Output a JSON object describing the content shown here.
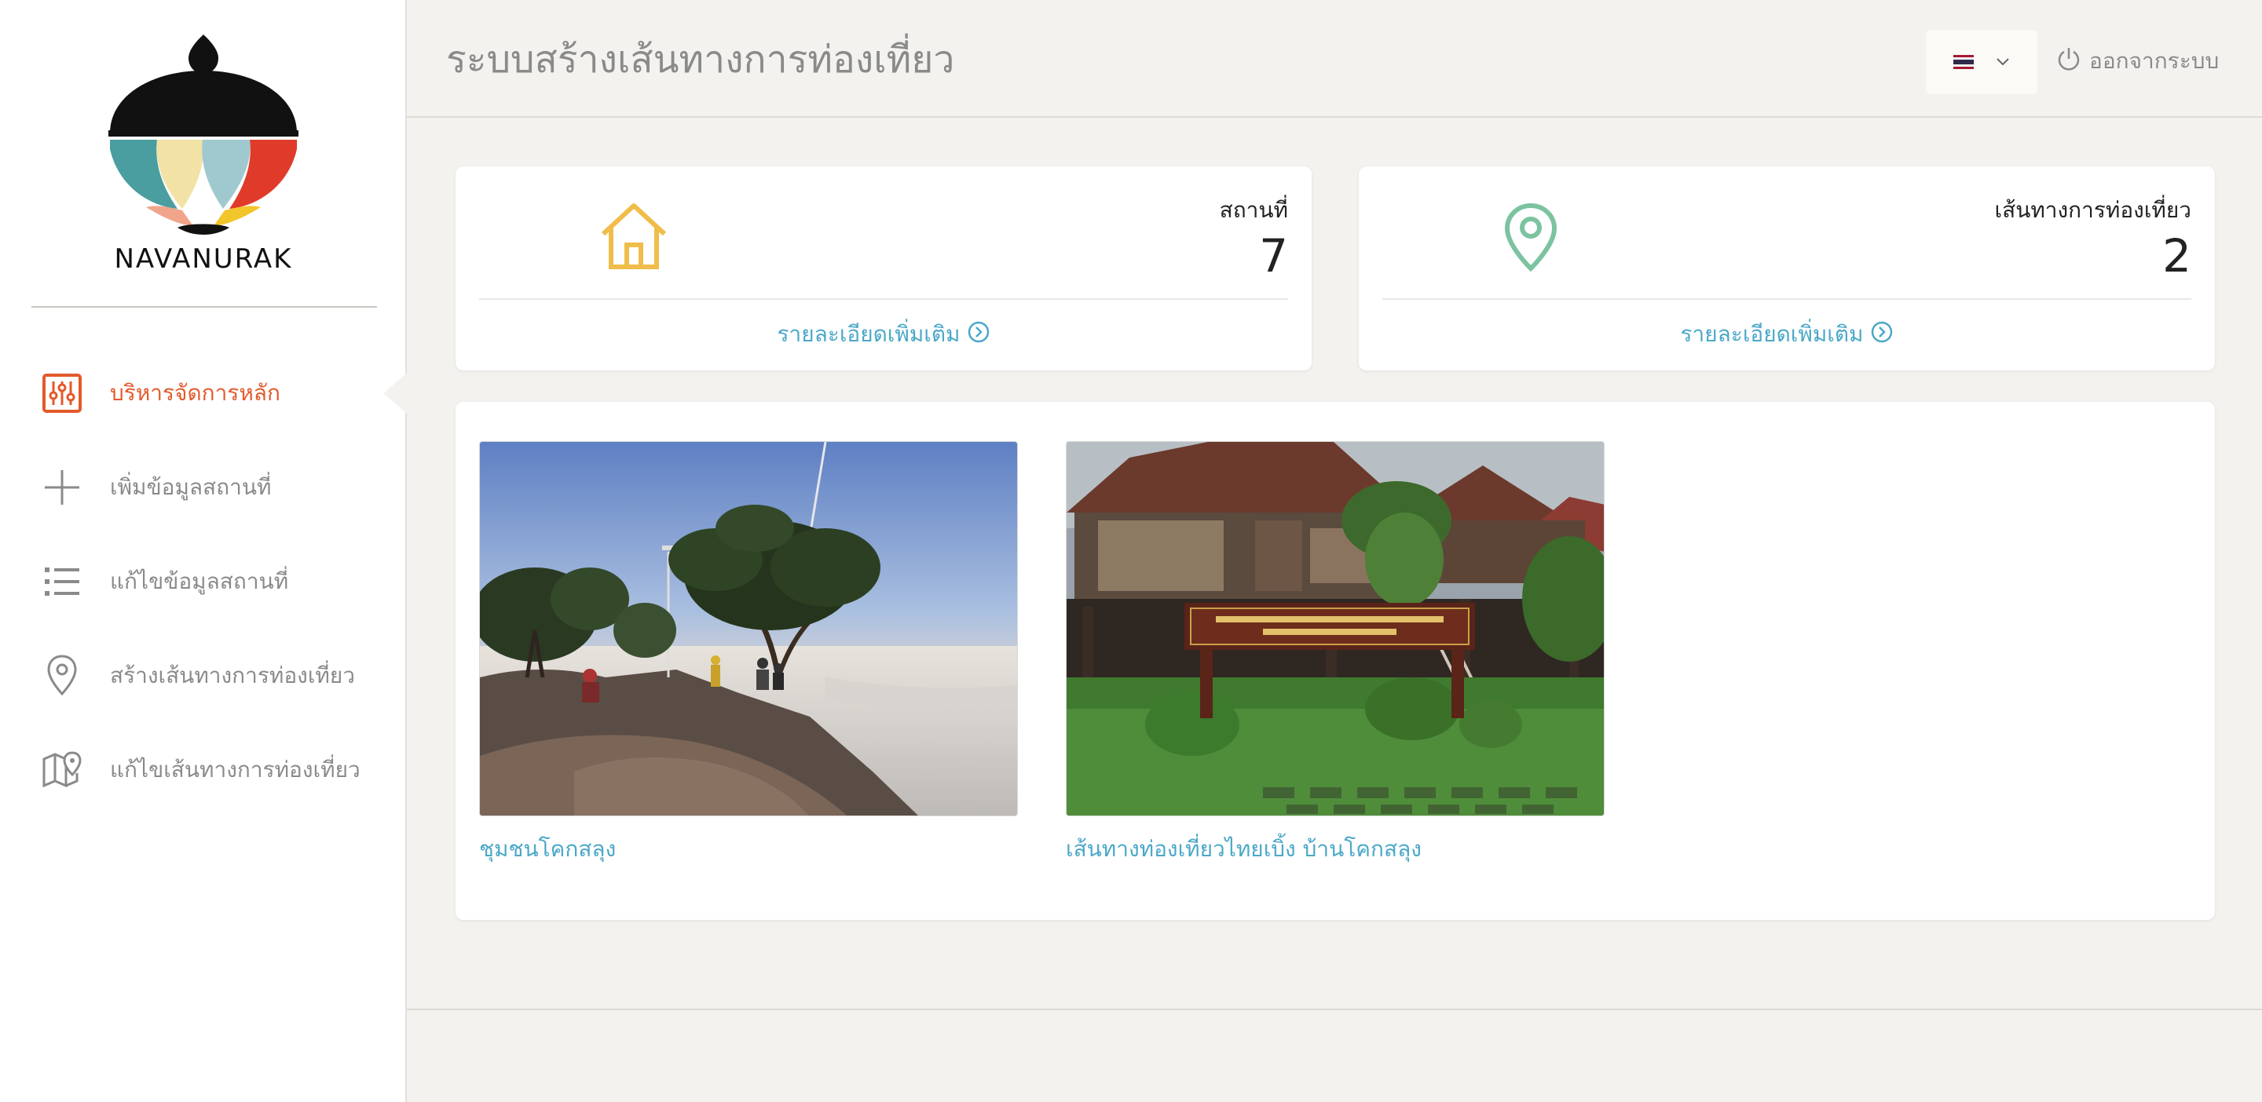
{
  "app": {
    "logo_text": "NAVANURAK",
    "title": "ระบบสร้างเส้นทางการท่องเที่ยว"
  },
  "header": {
    "language": {
      "selected": "Thai",
      "flag_colors": [
        "#a51931",
        "#f4f5f8",
        "#2d2a4a",
        "#f4f5f8",
        "#a51931"
      ]
    },
    "logout_label": "ออกจากระบบ"
  },
  "sidebar": {
    "items": [
      {
        "label": "บริหารจัดการหลัก",
        "icon": "sliders-icon",
        "active": true
      },
      {
        "label": "เพิ่มข้อมูลสถานที่",
        "icon": "plus-icon",
        "active": false
      },
      {
        "label": "แก้ไขข้อมูลสถานที่",
        "icon": "list-icon",
        "active": false
      },
      {
        "label": "สร้างเส้นทางการท่องเที่ยว",
        "icon": "map-pin-icon",
        "active": false
      },
      {
        "label": "แก้ไขเส้นทางการท่องเที่ยว",
        "icon": "map-edit-icon",
        "active": false
      }
    ]
  },
  "stats": {
    "places": {
      "label": "สถานที่",
      "value": "7",
      "link": "รายละเอียดเพิ่มเติม",
      "icon": "home-icon",
      "color": "#f0bd4a"
    },
    "routes": {
      "label": "เส้นทางการท่องเที่ยว",
      "value": "2",
      "link": "รายละเอียดเพิ่มเติม",
      "icon": "map-pin-icon",
      "color": "#7cc3a0"
    }
  },
  "routes": [
    {
      "title": "ชุมชนโคกสลุง",
      "image": "mountain-sunrise-photo"
    },
    {
      "title": "เส้นทางท่องเที่ยวไทยเบิ้ง บ้านโคกสลุง",
      "image": "museum-house-photo"
    }
  ],
  "colors": {
    "accent": "#e35a2b",
    "link": "#4ba8c8",
    "muted": "#8a8a8a",
    "background": "#f4f2ee"
  }
}
